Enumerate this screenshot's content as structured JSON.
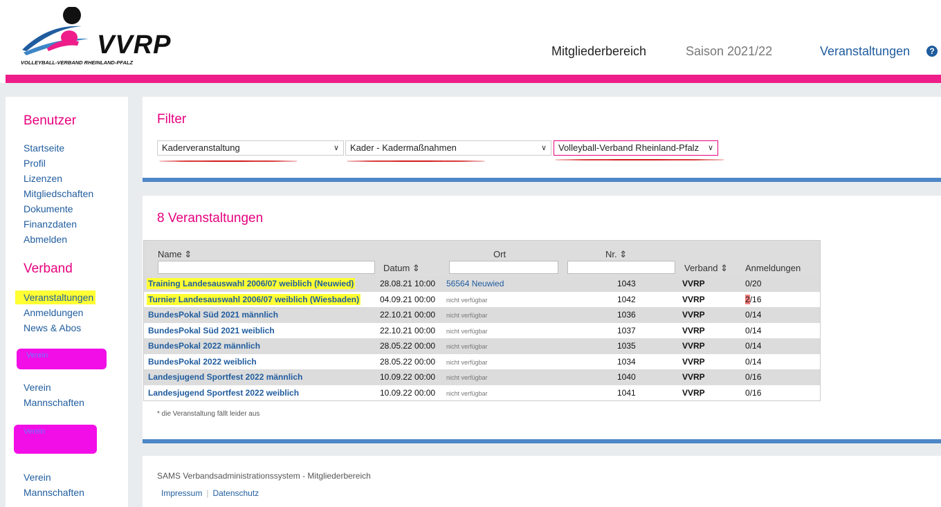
{
  "header": {
    "logo_text": "VVRP",
    "logo_subtitle": "VOLLEYBALL-VERBAND RHEINLAND-PFALZ",
    "nav": {
      "member_area": "Mitgliederbereich",
      "season": "Saison 2021/22",
      "events": "Veranstaltungen"
    },
    "help_icon": "?",
    "colors": {
      "brand_pink": "#ee1d8a",
      "link_blue": "#1f5c9e",
      "panel_border": "#4d87c7"
    }
  },
  "sidebar": {
    "user_heading": "Benutzer",
    "user_items": [
      "Startseite",
      "Profil",
      "Lizenzen",
      "Mitgliedschaften",
      "Dokumente",
      "Finanzdaten",
      "Abmelden"
    ],
    "verband_heading": "Verband",
    "verband_items": [
      "Veranstaltungen",
      "Anmeldungen",
      "News & Abos"
    ],
    "scribble1_text": "Verein",
    "verein1_items": [
      "Verein",
      "Mannschaften"
    ],
    "scribble2_text": "Verein",
    "verein2_items": [
      "Verein",
      "Mannschaften"
    ]
  },
  "filter": {
    "title": "Filter",
    "selects": [
      "Kaderveranstaltung",
      "Kader - Kadermaßnahmen",
      "Volleyball-Verband Rheinland-Pfalz"
    ]
  },
  "events": {
    "title": "8 Veranstaltungen",
    "columns": {
      "name": "Name",
      "datum": "Datum",
      "ort": "Ort",
      "nr": "Nr.",
      "verband": "Verband",
      "anmeldungen": "Anmeldungen"
    },
    "sort_icon": "⇕",
    "rows": [
      {
        "name": "Training Landesauswahl 2006/07 weiblich (Neuwied)",
        "datum": "28.08.21 10:00",
        "ort": "56564 Neuwied",
        "nr": "1043",
        "verband": "VVRP",
        "anm_a": "0",
        "anm_b": "/20"
      },
      {
        "name": "Turnier Landesauswahl 2006/07 weiblich (Wiesbaden)",
        "datum": "04.09.21 00:00",
        "ort": "nicht verfügbar",
        "nr": "1042",
        "verband": "VVRP",
        "anm_a": "2",
        "anm_b": "/16"
      },
      {
        "name": "BundesPokal Süd 2021 männlich",
        "datum": "22.10.21 00:00",
        "ort": "nicht verfügbar",
        "nr": "1036",
        "verband": "VVRP",
        "anm_a": "0",
        "anm_b": "/14"
      },
      {
        "name": "BundesPokal Süd 2021 weiblich",
        "datum": "22.10.21 00:00",
        "ort": "nicht verfügbar",
        "nr": "1037",
        "verband": "VVRP",
        "anm_a": "0",
        "anm_b": "/14"
      },
      {
        "name": "BundesPokal 2022 männlich",
        "datum": "28.05.22 00:00",
        "ort": "nicht verfügbar",
        "nr": "1035",
        "verband": "VVRP",
        "anm_a": "0",
        "anm_b": "/14"
      },
      {
        "name": "BundesPokal 2022 weiblich",
        "datum": "28.05.22 00:00",
        "ort": "nicht verfügbar",
        "nr": "1034",
        "verband": "VVRP",
        "anm_a": "0",
        "anm_b": "/14"
      },
      {
        "name": "Landesjugend Sportfest 2022 männlich",
        "datum": "10.09.22 00:00",
        "ort": "nicht verfügbar",
        "nr": "1040",
        "verband": "VVRP",
        "anm_a": "0",
        "anm_b": "/16"
      },
      {
        "name": "Landesjugend Sportfest 2022 weiblich",
        "datum": "10.09.22 00:00",
        "ort": "nicht verfügbar",
        "nr": "1041",
        "verband": "VVRP",
        "anm_a": "0",
        "anm_b": "/16"
      }
    ],
    "footnote": "* die Veranstaltung fällt leider aus"
  },
  "footer": {
    "system_text": "SAMS Verbandsadministrationssystem - Mitgliederbereich",
    "links": [
      "Impressum",
      "Datenschutz"
    ]
  }
}
